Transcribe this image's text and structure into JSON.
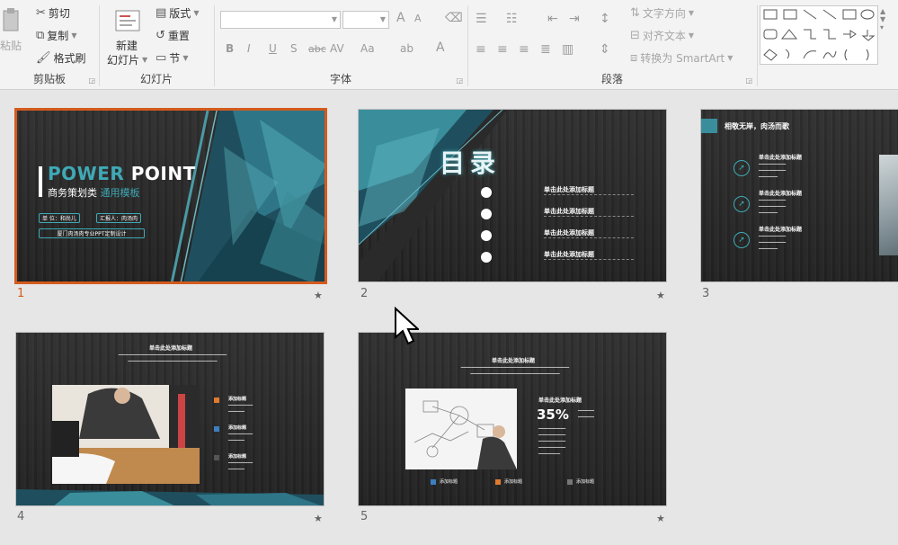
{
  "ribbon": {
    "clipboard": {
      "paste": "粘贴",
      "cut": "剪切",
      "copy": "复制",
      "format_painter": "格式刷",
      "label": "剪贴板"
    },
    "slides": {
      "new_slide_line1": "新建",
      "new_slide_line2": "幻灯片",
      "layout": "版式",
      "reset": "重置",
      "section": "节",
      "label": "幻灯片"
    },
    "font": {
      "font_size_up": "A",
      "font_size_down": "A",
      "bold": "B",
      "italic": "I",
      "underline": "U",
      "shadow": "S",
      "strike": "abc",
      "spacing": "AV",
      "case": "Aa",
      "font_color": "A",
      "label": "字体"
    },
    "paragraph": {
      "text_direction": "文字方向",
      "align_text": "对齐文本",
      "smartart": "转换为 SmartArt",
      "label": "段落"
    }
  },
  "slides": [
    {
      "number": "1",
      "title_a": "POWER",
      "title_b": "POINT",
      "subtitle_a": "商务策划类",
      "subtitle_b": "通用模板",
      "unit": "单 位：和尚儿",
      "reporter": "汇报人：肉汤肉",
      "footer": "厦门肉汤肉专业PPT定制设计"
    },
    {
      "number": "2",
      "heading": "目录",
      "items": [
        "单击此处添加标题",
        "单击此处添加标题",
        "单击此处添加标题",
        "单击此处添加标题"
      ]
    },
    {
      "number": "3",
      "header": "相敬无岸，肉汤而歌",
      "items": [
        "单击此处添加标题",
        "单击此处添加标题",
        "单击此处添加标题"
      ]
    },
    {
      "number": "4",
      "title": "单击此处添加标题",
      "legend": [
        "添加标题",
        "添加标题",
        "添加标题"
      ]
    },
    {
      "number": "5",
      "title": "单击此处添加标题",
      "right_title": "单击此处添加标题",
      "percent": "35%",
      "legend": [
        "添加标题",
        "添加标题",
        "添加标题"
      ]
    }
  ],
  "colors": {
    "selection": "#d35b1e",
    "accent_teal": "#3fa9b5",
    "accent_orange": "#e07a2e",
    "accent_blue": "#3d7fbf"
  }
}
